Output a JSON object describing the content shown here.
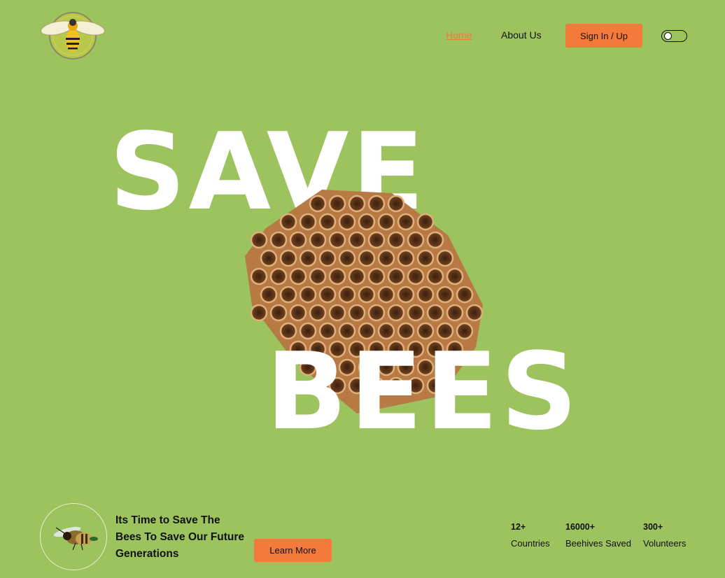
{
  "nav": {
    "home": "Home",
    "about": "About Us",
    "signin": "Sign In / Up"
  },
  "hero": {
    "line1": "SAVE",
    "line2": "BEES"
  },
  "bottom": {
    "tagline": "Its Time to Save The Bees To Save Our Future Generations",
    "learn_more": "Learn More",
    "stats": [
      {
        "value": "12+",
        "label": "Countries"
      },
      {
        "value": "16000+",
        "label": "Beehives Saved"
      },
      {
        "value": "300+",
        "label": "Volunteers"
      }
    ]
  },
  "colors": {
    "background": "#9cc35d",
    "accent": "#f47a3c",
    "hero_text": "#ffffff"
  },
  "icons": [
    "bee-logo-icon",
    "honeycomb-image",
    "bee-photo-icon",
    "theme-toggle"
  ],
  "toggle": {
    "state": "off"
  }
}
